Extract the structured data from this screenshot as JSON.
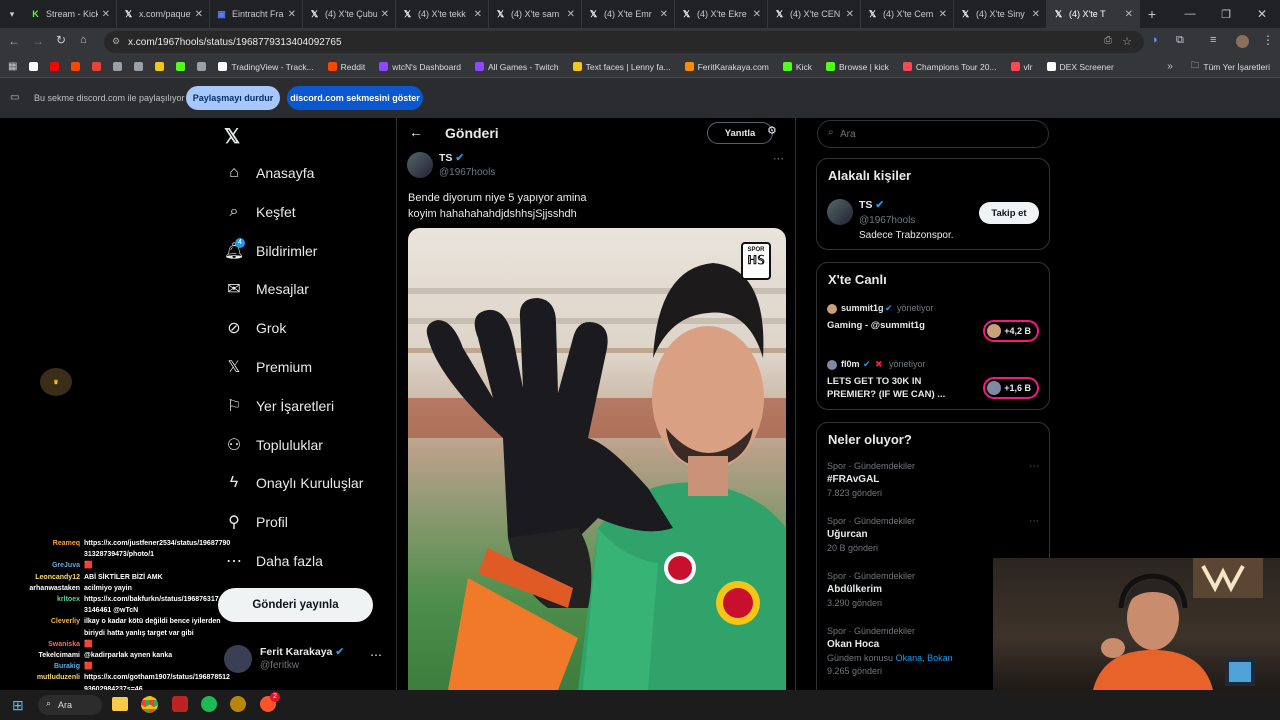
{
  "browser": {
    "tabs": [
      {
        "title": "Stream - Kick",
        "icon": "kick-icon",
        "color": "#53fc18"
      },
      {
        "title": "x.com/paquet",
        "icon": "x-icon",
        "color": "#ffffff"
      },
      {
        "title": "Eintracht Fra",
        "icon": "news-icon",
        "color": "#5b7cfa"
      },
      {
        "title": "(4) X'te Çubu",
        "icon": "x-icon",
        "color": "#ffffff"
      },
      {
        "title": "(4) X'te tekk",
        "icon": "x-icon",
        "color": "#ffffff"
      },
      {
        "title": "(4) X'te sam",
        "icon": "x-icon",
        "color": "#ffffff"
      },
      {
        "title": "(4) X'te Emr",
        "icon": "x-icon",
        "color": "#ffffff"
      },
      {
        "title": "(4) X'te Ekre",
        "icon": "x-icon",
        "color": "#ffffff"
      },
      {
        "title": "(4) X'te CEN",
        "icon": "x-icon",
        "color": "#ffffff"
      },
      {
        "title": "(4) X'te Cem",
        "icon": "x-icon",
        "color": "#ffffff"
      },
      {
        "title": "(4) X'te Siny",
        "icon": "x-icon",
        "color": "#ffffff"
      },
      {
        "title": "(4) X'te T",
        "icon": "x-icon",
        "color": "#ffffff"
      }
    ],
    "url": "x.com/1967hools/status/1968779313404092765",
    "bookmarks": [
      {
        "label": "",
        "color": "#ffffff"
      },
      {
        "label": "",
        "color": "#ff0000"
      },
      {
        "label": "",
        "color": "#ff4500"
      },
      {
        "label": "",
        "color": "#ea4335"
      },
      {
        "label": "",
        "color": "#9aa0a6"
      },
      {
        "label": "",
        "color": "#9aa0a6"
      },
      {
        "label": "",
        "color": "#f5c518"
      },
      {
        "label": "",
        "color": "#53fc18"
      },
      {
        "label": "",
        "color": "#9aa0a6"
      },
      {
        "label": "TradingView - Track...",
        "color": "#ffffff"
      },
      {
        "label": "Reddit",
        "color": "#ff4500"
      },
      {
        "label": "wtcN's Dashboard",
        "color": "#9146ff"
      },
      {
        "label": "All Games - Twitch",
        "color": "#9146ff"
      },
      {
        "label": "Text faces | Lenny fa...",
        "color": "#f5c518"
      },
      {
        "label": "FeritKarakaya.com",
        "color": "#ff8c00"
      },
      {
        "label": "Kick",
        "color": "#53fc18"
      },
      {
        "label": "Browse | kick",
        "color": "#53fc18"
      },
      {
        "label": "Champions Tour 20...",
        "color": "#ff4655"
      },
      {
        "label": "vlr",
        "color": "#ff4655"
      },
      {
        "label": "DEX Screener",
        "color": "#ffffff"
      }
    ],
    "all_bookmarks": "Tüm Yer İşaretleri"
  },
  "share": {
    "text": "Bu sekme discord.com ile paylaşılıyor",
    "stop_label": "Paylaşmayı durdur",
    "show_label": "discord.com sekmesini göster"
  },
  "nav": {
    "items": [
      {
        "label": "Anasayfa",
        "icon": "home-icon"
      },
      {
        "label": "Keşfet",
        "icon": "search-icon"
      },
      {
        "label": "Bildirimler",
        "icon": "bell-icon",
        "badge": "4"
      },
      {
        "label": "Mesajlar",
        "icon": "mail-icon"
      },
      {
        "label": "Grok",
        "icon": "grok-icon"
      },
      {
        "label": "Premium",
        "icon": "x-icon"
      },
      {
        "label": "Yer İşaretleri",
        "icon": "bookmark-icon"
      },
      {
        "label": "Topluluklar",
        "icon": "communities-icon"
      },
      {
        "label": "Onaylı Kuruluşlar",
        "icon": "lightning-icon"
      },
      {
        "label": "Profil",
        "icon": "profile-icon"
      },
      {
        "label": "Daha fazla",
        "icon": "more-icon"
      }
    ],
    "post_button": "Gönderi yayınla",
    "account": {
      "name": "Ferit Karakaya",
      "handle": "@feritkw"
    }
  },
  "post": {
    "header": "Gönderi",
    "reply_label": "Yanıtla",
    "author": "TS",
    "handle": "@1967hools",
    "text_line1": "Bende diyorum niye 5 yapıyor amina",
    "text_line2": "koyim hahahahahdjdshhsjSjjsshdh",
    "image_badge": "SPOR"
  },
  "search": {
    "placeholder": "Ara"
  },
  "related": {
    "title": "Alakalı kişiler",
    "name": "TS",
    "handle": "@1967hools",
    "bio": "Sadece Trabzonspor.",
    "follow_label": "Takip et"
  },
  "live": {
    "title": "X'te Canlı",
    "items": [
      {
        "host": "summit1g",
        "role": "yönetiyor",
        "title": "Gaming - @summit1g",
        "count": "+4,2 B"
      },
      {
        "host": "fl0m",
        "role": "yönetiyor",
        "title1": "LETS GET TO 30K IN",
        "title2": "PREMIER? (IF WE CAN) ...",
        "count": "+1,6 B"
      }
    ]
  },
  "trends": {
    "title": "Neler oluyor?",
    "items": [
      {
        "cat": "Spor · Gündemdekiler",
        "name": "#FRAvGAL",
        "posts": "7.823 gönderi"
      },
      {
        "cat": "Spor · Gündemdekiler",
        "name": "Uğurcan",
        "posts": "20 B gönderi"
      },
      {
        "cat": "Spor · Gündemdekiler",
        "name": "Abdülkerim",
        "posts": "3.290 gönderi"
      },
      {
        "cat": "Spor · Gündemdekiler",
        "name": "Okan Hoca",
        "sub": "Gündem konusu",
        "links": "Okana, Bokan",
        "posts": "9.265 gönderi"
      }
    ]
  },
  "chat": [
    {
      "user": "Reameq",
      "color": "#ff9f43",
      "msg": "https://x.com/justfener2534/status/19687790"
    },
    {
      "user": "",
      "color": "#ffffff",
      "msg": "31328739473/photo/1"
    },
    {
      "user": "GreJuva",
      "color": "#5dade2",
      "msg": "🟥"
    },
    {
      "user": "Leoncandy12",
      "color": "#f7dc6f",
      "msg": "ABİ SİKTİLER BİZİ AMK"
    },
    {
      "user": "arhanwastaken",
      "color": "#ffffff",
      "msg": "acilmiyo yayin"
    },
    {
      "user": "krltoex",
      "color": "#58d68d",
      "msg": "https://x.com/bakfurkn/status/196876317"
    },
    {
      "user": "",
      "color": "#ffffff",
      "msg": "3146461 @wTcN"
    },
    {
      "user": "Cleverliy",
      "color": "#f5b041",
      "msg": "ilkay o kadar kötü değildi bence iyilerden"
    },
    {
      "user": "",
      "color": "#ffffff",
      "msg": "biriydi hatta yanlış target var gibi"
    },
    {
      "user": "Swaniska",
      "color": "#ec7063",
      "msg": "🟥"
    },
    {
      "user": "Tekelcimami",
      "color": "#ffffff",
      "msg": "@kadirparlak aynen kanka"
    },
    {
      "user": "Burakig",
      "color": "#5dade2",
      "msg": "🟥"
    },
    {
      "user": "mutluduzenli",
      "color": "#f7dc6f",
      "msg": "https://x.com/gotham1907/status/196878512"
    },
    {
      "user": "",
      "color": "#ffffff",
      "msg": "93602984237s=46"
    },
    {
      "user": "hermos",
      "color": "#ffffff",
      "msg": "🟥"
    }
  ],
  "taskbar": {
    "search_label": "Ara",
    "notif_count": "2"
  }
}
